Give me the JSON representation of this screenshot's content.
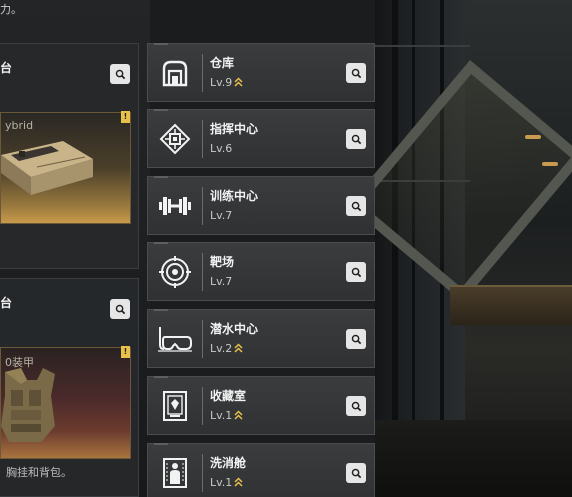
{
  "top_hint": "力。",
  "left_panels": [
    {
      "title": "台",
      "card_name": "ybrid",
      "badge": "!",
      "footer": ""
    },
    {
      "title": "台",
      "card_name": "0装甲",
      "badge": "!",
      "footer": "胸挂和背包。"
    }
  ],
  "facilities": [
    {
      "name": "仓库",
      "level": "Lv.9",
      "upgradable": true,
      "icon": "warehouse-icon"
    },
    {
      "name": "指挥中心",
      "level": "Lv.6",
      "upgradable": false,
      "icon": "command-center-icon"
    },
    {
      "name": "训练中心",
      "level": "Lv.7",
      "upgradable": false,
      "icon": "dumbbell-icon"
    },
    {
      "name": "靶场",
      "level": "Lv.7",
      "upgradable": false,
      "icon": "target-icon"
    },
    {
      "name": "潜水中心",
      "level": "Lv.2",
      "upgradable": true,
      "icon": "diving-mask-icon"
    },
    {
      "name": "收藏室",
      "level": "Lv.1",
      "upgradable": true,
      "icon": "collection-icon"
    },
    {
      "name": "洗消舱",
      "level": "Lv.1",
      "upgradable": true,
      "icon": "decontamination-icon"
    }
  ],
  "colors": {
    "accent_gold": "#e8c04a",
    "panel_bg": "#2f3133",
    "search_button": "#e6e6e6"
  }
}
